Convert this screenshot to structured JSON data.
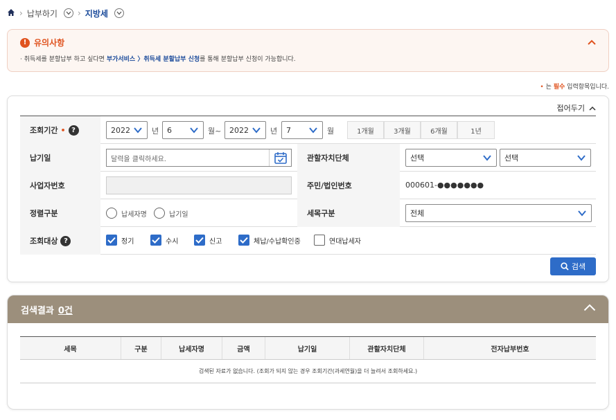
{
  "breadcrumb": {
    "level1": "납부하기",
    "level2": "지방세"
  },
  "notice": {
    "title": "유의사항",
    "text_before": "· 취득세를 분할납부 하고 싶다면 ",
    "text_link": "부가서비스 〉취득세 분할납부 신청",
    "text_after": "를 통해 분할납부 신청이 가능합니다."
  },
  "required_note": {
    "mark": "•",
    "before": " 는 ",
    "bold": "필수",
    "after": " 입력항목입니다."
  },
  "panel": {
    "collapse_label": "접어두기"
  },
  "form": {
    "period_label": "조회기간",
    "required_mark": "•",
    "help_icon": "?",
    "start_year": "2022",
    "year_unit": "년",
    "start_month": "6",
    "month_unit_tilde": "월~",
    "end_year": "2022",
    "end_month": "7",
    "month_unit": "월",
    "quick_periods": [
      "1개월",
      "3개월",
      "6개월",
      "1년"
    ],
    "due_date_label": "납기일",
    "due_date_placeholder": "달력을 클릭하세요.",
    "jurisdiction_label": "관할자치단체",
    "jurisdiction_select1": "선택",
    "jurisdiction_select2": "선택",
    "business_no_label": "사업자번호",
    "business_no_value": "",
    "resident_no_label": "주민/법인번호",
    "resident_no_value": "000601-●●●●●●●",
    "regular_label": "정렬구분",
    "radio_options": [
      "납세자명",
      "납기일"
    ],
    "tax_type_label": "세목구분",
    "tax_type_value": "전체",
    "target_label": "조회대상",
    "checkboxes": [
      {
        "label": "정기",
        "checked": true
      },
      {
        "label": "수시",
        "checked": true
      },
      {
        "label": "신고",
        "checked": true
      },
      {
        "label": "체납/수납확인중",
        "checked": true
      },
      {
        "label": "연대납세자",
        "checked": false
      }
    ],
    "search_label": "검색"
  },
  "results": {
    "title": "검색결과",
    "count": "0건",
    "columns": [
      "세목",
      "구분",
      "납세자명",
      "금액",
      "납기일",
      "관할자치단체",
      "전자납부번호"
    ],
    "empty_message": "검색된 자료가 없습니다. (조회가 되지 않는 경우 조회기간(과세연월)을 더 늘려서 조회하세요.)"
  },
  "colors": {
    "accent_blue": "#2e6cc8",
    "warn_orange": "#e0531f",
    "results_header": "#9c8f7c"
  }
}
